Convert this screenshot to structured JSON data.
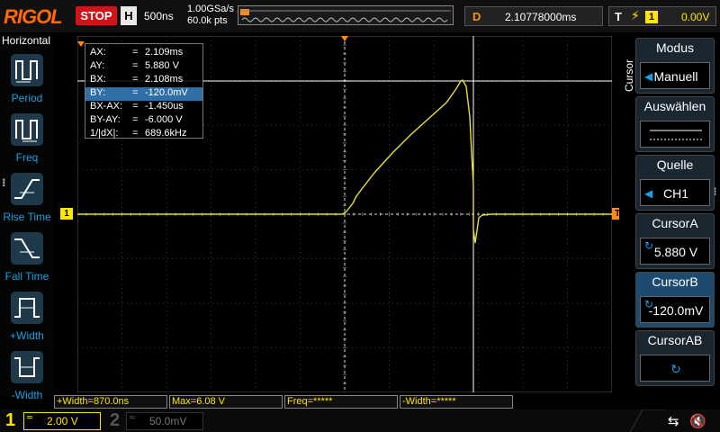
{
  "topbar": {
    "brand": "RIGOL",
    "run_state": "STOP",
    "timebase_label": "H",
    "timebase_value": "500ns",
    "sample_rate": "1.00GSa/s",
    "memory_depth": "60.0k pts",
    "delay_label": "D",
    "delay_value": "2.10778000ms",
    "trigger_label": "T",
    "trigger_icon": "rising-edge-icon",
    "trigger_source": "1",
    "trigger_level": "0.00V"
  },
  "left_panel": {
    "title": "Horizontal",
    "items": [
      {
        "label": "Period",
        "icon": "period-icon"
      },
      {
        "label": "Freq",
        "icon": "freq-icon"
      },
      {
        "label": "Rise Time",
        "icon": "rise-time-icon"
      },
      {
        "label": "Fall Time",
        "icon": "fall-time-icon"
      },
      {
        "label": "+Width",
        "icon": "pos-width-icon"
      },
      {
        "label": "-Width",
        "icon": "neg-width-icon"
      }
    ]
  },
  "cursor_readout": {
    "rows": [
      {
        "key": "AX:",
        "eq": "=",
        "value": "2.109ms"
      },
      {
        "key": "AY:",
        "eq": "=",
        "value": "5.880 V"
      },
      {
        "key": "BX:",
        "eq": "=",
        "value": "2.108ms"
      },
      {
        "key": "BY:",
        "eq": "=",
        "value": "-120.0mV"
      },
      {
        "key": "BX-AX:",
        "eq": "=",
        "value": "-1.450us"
      },
      {
        "key": "BY-AY:",
        "eq": "=",
        "value": "-6.000 V"
      },
      {
        "key": "1/|dX|:",
        "eq": "=",
        "value": "689.6kHz"
      }
    ],
    "highlighted_index": 3
  },
  "markers": {
    "ch1_marker": "1",
    "trigger_marker": "T"
  },
  "right_panel": {
    "side_label": "Cursor",
    "items": [
      {
        "title": "Modus",
        "value": "Manuell",
        "arrow": "◀"
      },
      {
        "title": "Auswählen",
        "value": ""
      },
      {
        "title": "Quelle",
        "value": "CH1",
        "arrow": "◀"
      },
      {
        "title": "CursorA",
        "value": "5.880 V",
        "knob": "↻"
      },
      {
        "title": "CursorB",
        "value": "-120.0mV",
        "knob": "↻"
      },
      {
        "title": "CursorAB",
        "value": "",
        "knob": "↻"
      }
    ]
  },
  "measurements": {
    "pos_width": "+Width=870.0ns",
    "max": "Max=6.08 V",
    "freq": "Freq=*****",
    "neg_width": "-Width=*****"
  },
  "channels": {
    "ch1": {
      "number": "1",
      "coupling_symbol": "═",
      "scale": "2.00 V",
      "color": "#ffe600"
    },
    "ch2": {
      "number": "2",
      "coupling_symbol": "═",
      "scale": "50.0mV",
      "color": "#555555"
    }
  },
  "status_icons": {
    "usb": "usb-icon",
    "sound": "speaker-mute-icon"
  },
  "colors": {
    "trace": "#e8e030",
    "accent_blue": "#19a0e0",
    "stop_red": "#d0141a",
    "brand_orange": "#ff6a00"
  }
}
